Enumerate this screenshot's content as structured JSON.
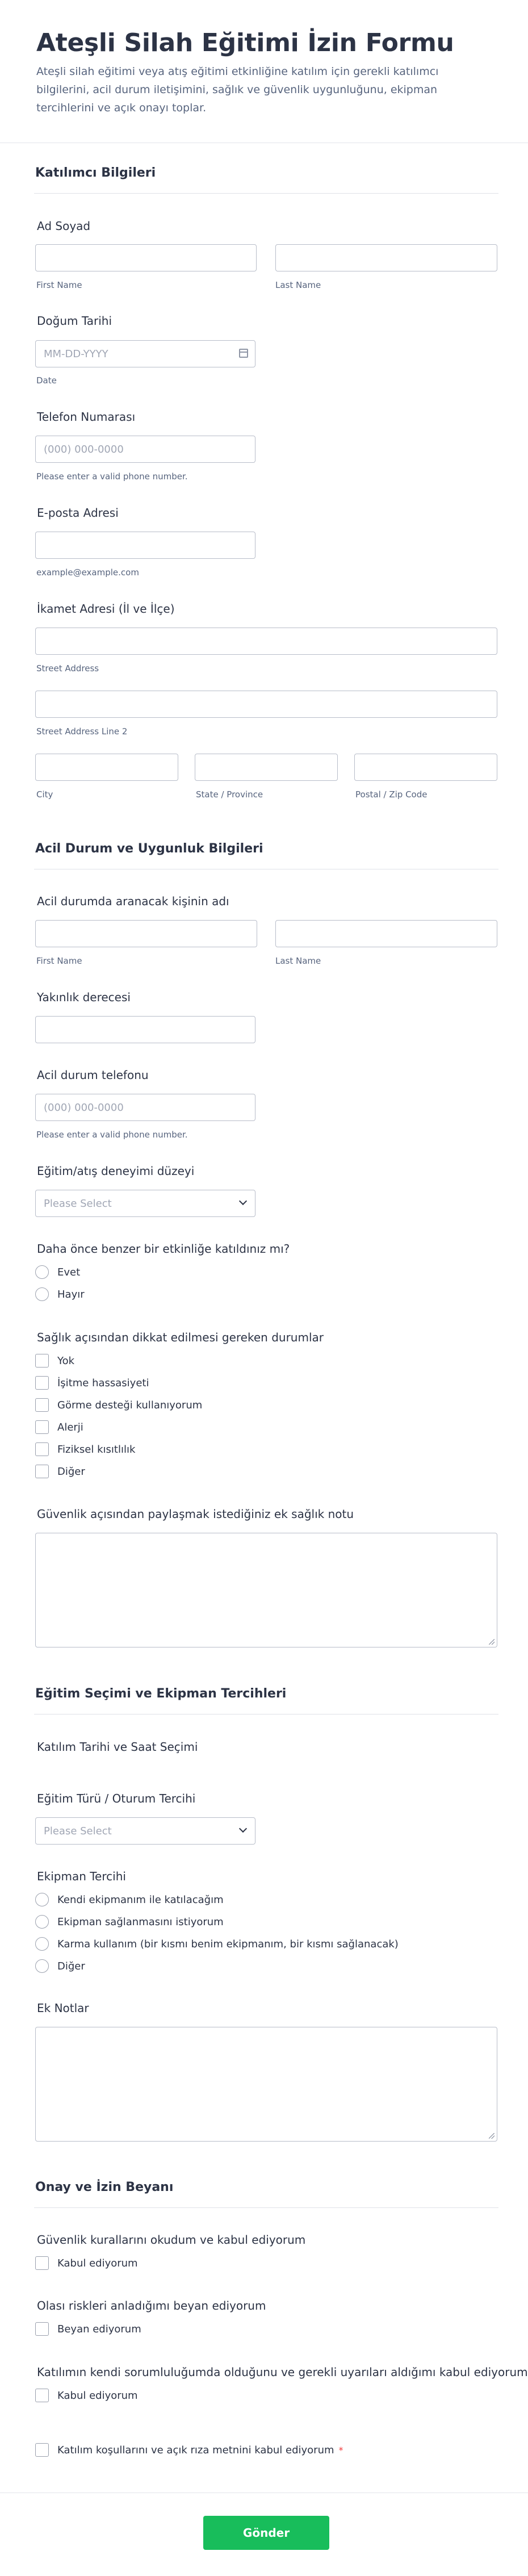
{
  "form": {
    "title": "Ateşli Silah Eğitimi İzin Formu",
    "description": "Ateşli silah eğitimi veya atış eğitimi etkinliğine katılım için gerekli katılımcı bilgilerini, acil durum iletişimini, sağlık ve güvenlik uygunluğunu, ekipman tercihlerini ve açık onayı toplar."
  },
  "section1": {
    "title": "Katılımcı Bilgileri",
    "name_label": "Ad Soyad",
    "first_name": "First Name",
    "last_name": "Last Name",
    "dob_label": "Doğum Tarihi",
    "dob_placeholder": "MM-DD-YYYY",
    "dob_sublabel": "Date",
    "phone_label": "Telefon Numarası",
    "phone_placeholder": "(000) 000-0000",
    "phone_sublabel": "Please enter a valid phone number.",
    "email_label": "E-posta Adresi",
    "email_sublabel": "example@example.com",
    "address_label": "İkamet Adresi (İl ve İlçe)",
    "street1": "Street Address",
    "street2": "Street Address Line 2",
    "city": "City",
    "state": "State / Province",
    "zip": "Postal / Zip Code"
  },
  "section2": {
    "title": "Acil Durum ve Uygunluk Bilgileri",
    "contact_name_label": "Acil durumda aranacak kişinin adı",
    "first_name": "First Name",
    "last_name": "Last Name",
    "relation_label": "Yakınlık derecesi",
    "phone_label": "Acil durum telefonu",
    "phone_placeholder": "(000) 000-0000",
    "phone_sublabel": "Please enter a valid phone number.",
    "experience_label": "Eğitim/atış deneyimi düzeyi",
    "experience_placeholder": "Please Select",
    "attended_label": "Daha önce benzer bir etkinliğe katıldınız mı?",
    "attended_options": [
      "Evet",
      "Hayır"
    ],
    "health_label": "Sağlık açısından dikkat edilmesi gereken durumlar",
    "health_options": [
      "Yok",
      "İşitme hassasiyeti",
      "Görme desteği kullanıyorum",
      "Alerji",
      "Fiziksel kısıtlılık",
      "Diğer"
    ],
    "note_label": "Güvenlik açısından paylaşmak istediğiniz ek sağlık notu"
  },
  "section3": {
    "title": "Eğitim Seçimi ve Ekipman Tercihleri",
    "datetime_label": "Katılım Tarihi ve Saat Seçimi",
    "type_label": "Eğitim Türü / Oturum Tercihi",
    "type_placeholder": "Please Select",
    "equipment_label": "Ekipman Tercihi",
    "equipment_options": [
      "Kendi ekipmanım ile katılacağım",
      "Ekipman sağlanmasını istiyorum",
      "Karma kullanım (bir kısmı benim ekipmanım, bir kısmı sağlanacak)",
      "Diğer"
    ],
    "notes_label": "Ek Notlar"
  },
  "section4": {
    "title": "Onay ve İzin Beyanı",
    "rules_label": "Güvenlik kurallarını okudum ve kabul ediyorum",
    "rules_option": "Kabul ediyorum",
    "risks_label": "Olası riskleri anladığımı beyan ediyorum",
    "risks_option": "Beyan ediyorum",
    "responsibility_label": "Katılımın kendi sorumluluğumda olduğunu ve gerekli uyarıları aldığımı kabul ediyorum",
    "responsibility_option": "Kabul ediyorum",
    "terms_text": "Katılım koşullarını ve açık rıza metnini kabul ediyorum",
    "required_mark": "*"
  },
  "submit_label": "Gönder",
  "colors": {
    "accent": "#18bd5b",
    "required": "#f23a3c",
    "text": "#2c3345",
    "muted": "#57647e"
  }
}
